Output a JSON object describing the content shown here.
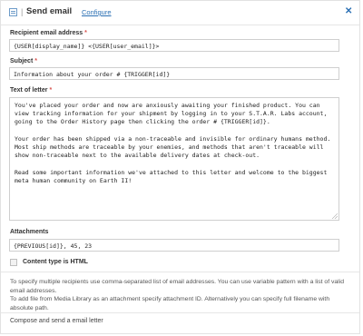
{
  "header": {
    "title": "Send email",
    "separator": "|",
    "configure_label": "Configure",
    "close_glyph": "✕",
    "icon": "email-icon"
  },
  "recipient": {
    "label": "Recipient email address",
    "required_mark": "*",
    "value": "{USER[display_name]} <{USER[user_email]}>"
  },
  "subject": {
    "label": "Subject",
    "required_mark": "*",
    "value": "Information about your order # {TRIGGER[id]}"
  },
  "letter": {
    "label": "Text of letter",
    "required_mark": "*",
    "paragraphs": [
      "You've placed your order and now are anxiously awaiting your finished product. You can view tracking information for your shipment by logging in to your S.T.A.R. Labs account, going to the Order History page then clicking the order # {TRIGGER[id]}.",
      "Your order has been shipped via a non-traceable and invisible for ordinary humans method. Most ship methods are traceable by your enemies, and methods that aren't traceable will show non-traceable next to the available delivery dates at check-out.",
      "Read some important information we've attached to this letter and welcome to the biggest meta human community on Earth II!"
    ]
  },
  "attachments": {
    "label": "Attachments",
    "value": "{PREVIOUS[id]}, 45, 23"
  },
  "content_type": {
    "label": "Content type is HTML",
    "checked": false
  },
  "help": [
    "To specify multiple recipients use comma-separated list of email addresses. You can use variable pattern with a list of valid email addresses.",
    "To add file from Media Library as an attachment specify attachment ID. Alternatively you can specify full filename with absolute path."
  ],
  "footer": {
    "description": "Compose and send a email letter"
  },
  "colors": {
    "link": "#2a6fb3",
    "required": "#d9534f"
  }
}
